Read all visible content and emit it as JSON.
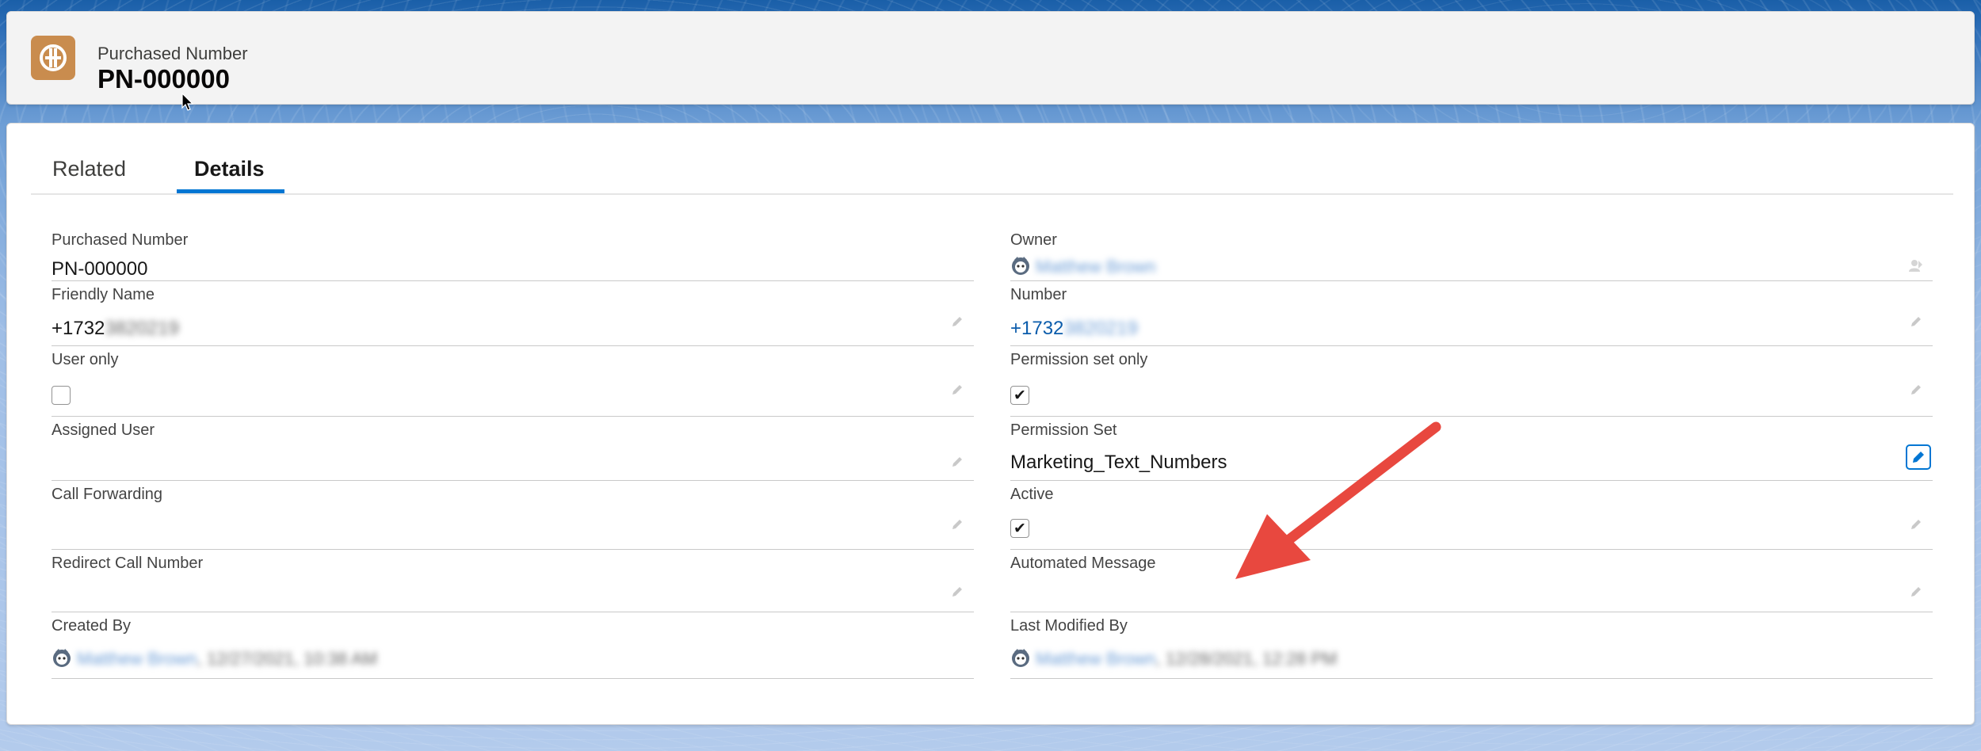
{
  "header": {
    "object_type": "Purchased Number",
    "record_name": "PN-000000"
  },
  "tabs": [
    {
      "label": "Related",
      "active": false
    },
    {
      "label": "Details",
      "active": true
    }
  ],
  "left_fields": {
    "purchased_number": {
      "label": "Purchased Number",
      "value": "PN-000000"
    },
    "friendly_name": {
      "label": "Friendly Name",
      "value": "+1732",
      "value_redacted": "3820219"
    },
    "user_only": {
      "label": "User only",
      "checked": false
    },
    "assigned_user": {
      "label": "Assigned User",
      "value": ""
    },
    "call_forwarding": {
      "label": "Call Forwarding",
      "value": ""
    },
    "redirect_call_number": {
      "label": "Redirect Call Number",
      "value": ""
    },
    "created_by": {
      "label": "Created By",
      "user": "Matthew Brown",
      "timestamp": ", 12/27/2021, 10:38 AM"
    }
  },
  "right_fields": {
    "owner": {
      "label": "Owner",
      "user": "Matthew Brown"
    },
    "number": {
      "label": "Number",
      "value": "+1732",
      "value_redacted": "3820219"
    },
    "permission_set_only": {
      "label": "Permission set only",
      "checked": true
    },
    "permission_set": {
      "label": "Permission Set",
      "value": "Marketing_Text_Numbers"
    },
    "active": {
      "label": "Active",
      "checked": true
    },
    "automated_message": {
      "label": "Automated Message",
      "value": ""
    },
    "last_modified_by": {
      "label": "Last Modified By",
      "user": "Matthew Brown",
      "timestamp": ", 12/28/2021, 12:28 PM"
    }
  },
  "annotation": {
    "arrow_color": "#e8483f"
  },
  "colors": {
    "accent": "#0176d3",
    "icon_bg": "#c98c4e",
    "link": "#0b5cab"
  }
}
